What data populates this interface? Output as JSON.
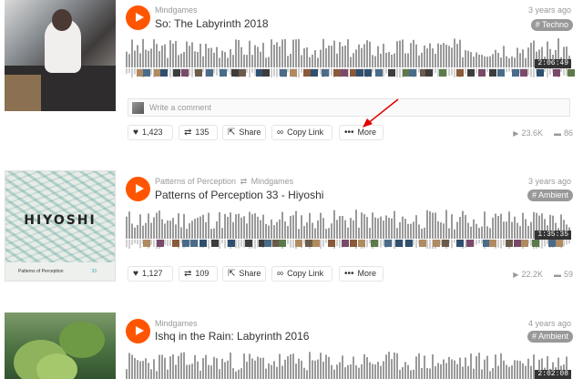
{
  "tracks": [
    {
      "artist": "Mindgames",
      "title": "So: The Labyrinth 2018",
      "ago": "3 years ago",
      "tag": "# Techno",
      "duration": "2:06:49",
      "comment_placeholder": "Write a comment",
      "likes": "1,423",
      "reposts": "135",
      "share": "Share",
      "copy_link": "Copy Link",
      "more": "More",
      "plays": "23.6K",
      "comments": "86"
    },
    {
      "artist": "Patterns of Perception",
      "reposted_by": "Mindgames",
      "title": "Patterns of Perception 33 - Hiyoshi",
      "ago": "3 years ago",
      "tag": "# Ambient",
      "duration": "1:35:35",
      "art_title": "HIYOSHI",
      "art_footer": "Patterns of Perception",
      "art_number": "33",
      "likes": "1,127",
      "reposts": "109",
      "share": "Share",
      "copy_link": "Copy Link",
      "more": "More",
      "plays": "22.2K",
      "comments": "59"
    },
    {
      "artist": "Mindgames",
      "title": "Ishq in the Rain: Labyrinth 2016",
      "ago": "4 years ago",
      "tag": "# Ambient",
      "duration": "2:02:08"
    }
  ],
  "icons": {
    "play": "play-icon",
    "like": "heart-icon",
    "repost": "repost-icon",
    "share": "share-icon",
    "link": "link-icon",
    "more": "ellipsis-icon",
    "plays": "play-count-icon",
    "comments": "comment-icon"
  },
  "colors": {
    "accent": "#ff5500",
    "waveform": "#999999",
    "tag_bg": "#999999",
    "annotation_arrow": "#e00000"
  }
}
